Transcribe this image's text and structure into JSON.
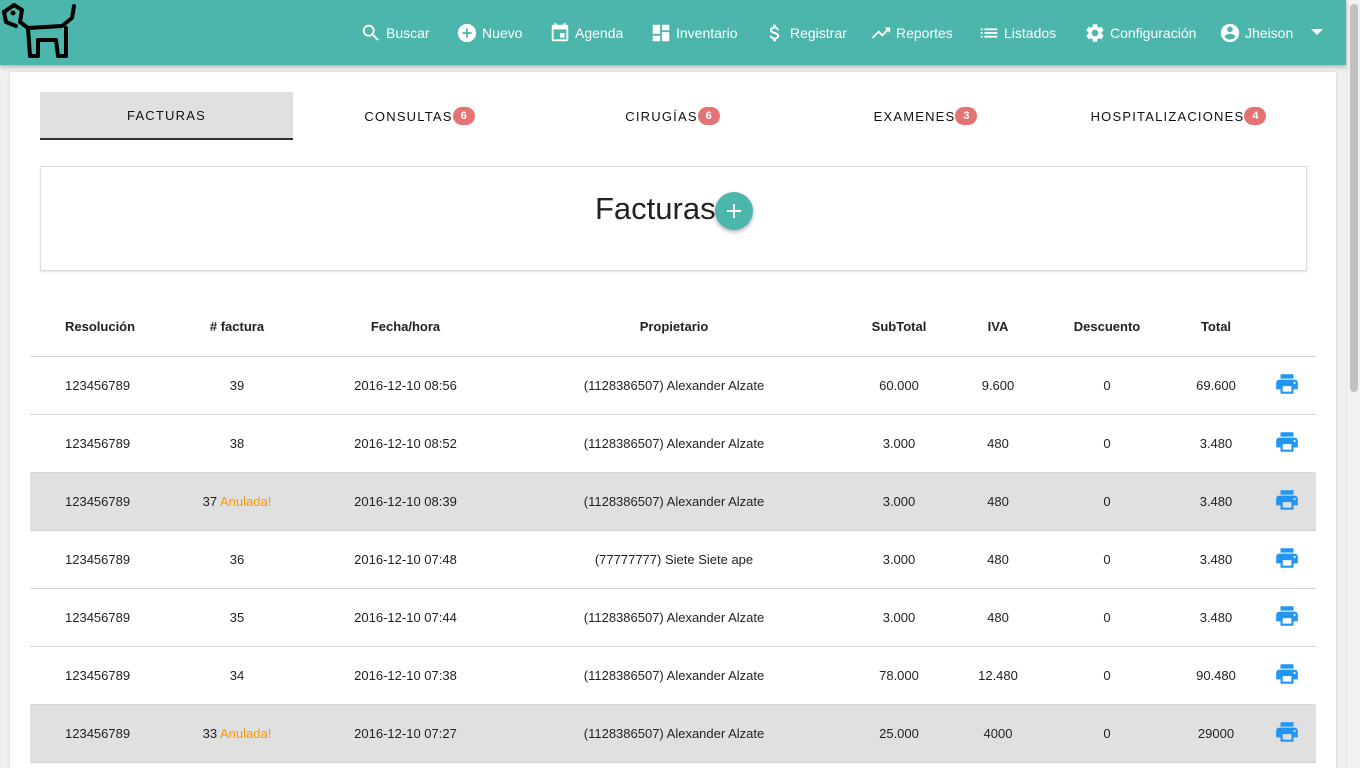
{
  "nav": {
    "items": [
      {
        "id": "buscar",
        "label": "Buscar",
        "icon": "search-icon"
      },
      {
        "id": "nuevo",
        "label": "Nuevo",
        "icon": "add-circle-icon"
      },
      {
        "id": "agenda",
        "label": "Agenda",
        "icon": "calendar-icon"
      },
      {
        "id": "inventario",
        "label": "Inventario",
        "icon": "dashboard-icon"
      },
      {
        "id": "registrar",
        "label": "Registrar",
        "icon": "dollar-icon"
      },
      {
        "id": "reportes",
        "label": "Reportes",
        "icon": "trending-up-icon"
      },
      {
        "id": "listados",
        "label": "Listados",
        "icon": "list-icon"
      },
      {
        "id": "configuracion",
        "label": "Configuración",
        "icon": "gear-icon"
      }
    ],
    "user": {
      "label": "Jheison",
      "icon": "account-circle-icon"
    },
    "brand_color": "#4db6ac"
  },
  "tabs": [
    {
      "label": "FACTURAS",
      "badge": null,
      "active": true
    },
    {
      "label": "CONSULTAS",
      "badge": "6"
    },
    {
      "label": "CIRUGÍAS",
      "badge": "6"
    },
    {
      "label": "EXAMENES",
      "badge": "3"
    },
    {
      "label": "HOSPITALIZACIONES",
      "badge": "4"
    }
  ],
  "section": {
    "title": "Facturas"
  },
  "table": {
    "headers": [
      "Resolución",
      "# factura",
      "Fecha/hora",
      "Propietario",
      "SubTotal",
      "IVA",
      "Descuento",
      "Total"
    ],
    "annulled_label": "Anulada!",
    "rows": [
      {
        "resolucion": "123456789",
        "factura": "39",
        "anulada": false,
        "fecha": "2016-12-10 08:56",
        "propietario": "(1128386507) Alexander Alzate",
        "subtotal": "60.000",
        "iva": "9.600",
        "descuento": "0",
        "total": "69.600"
      },
      {
        "resolucion": "123456789",
        "factura": "38",
        "anulada": false,
        "fecha": "2016-12-10 08:52",
        "propietario": "(1128386507) Alexander Alzate",
        "subtotal": "3.000",
        "iva": "480",
        "descuento": "0",
        "total": "3.480"
      },
      {
        "resolucion": "123456789",
        "factura": "37",
        "anulada": true,
        "fecha": "2016-12-10 08:39",
        "propietario": "(1128386507) Alexander Alzate",
        "subtotal": "3.000",
        "iva": "480",
        "descuento": "0",
        "total": "3.480"
      },
      {
        "resolucion": "123456789",
        "factura": "36",
        "anulada": false,
        "fecha": "2016-12-10 07:48",
        "propietario": "(77777777) Siete Siete ape",
        "subtotal": "3.000",
        "iva": "480",
        "descuento": "0",
        "total": "3.480"
      },
      {
        "resolucion": "123456789",
        "factura": "35",
        "anulada": false,
        "fecha": "2016-12-10 07:44",
        "propietario": "(1128386507) Alexander Alzate",
        "subtotal": "3.000",
        "iva": "480",
        "descuento": "0",
        "total": "3.480"
      },
      {
        "resolucion": "123456789",
        "factura": "34",
        "anulada": false,
        "fecha": "2016-12-10 07:38",
        "propietario": "(1128386507) Alexander Alzate",
        "subtotal": "78.000",
        "iva": "12.480",
        "descuento": "0",
        "total": "90.480"
      },
      {
        "resolucion": "123456789",
        "factura": "33",
        "anulada": true,
        "fecha": "2016-12-10 07:27",
        "propietario": "(1128386507) Alexander Alzate",
        "subtotal": "25.000",
        "iva": "4000",
        "descuento": "0",
        "total": "29000"
      }
    ]
  }
}
